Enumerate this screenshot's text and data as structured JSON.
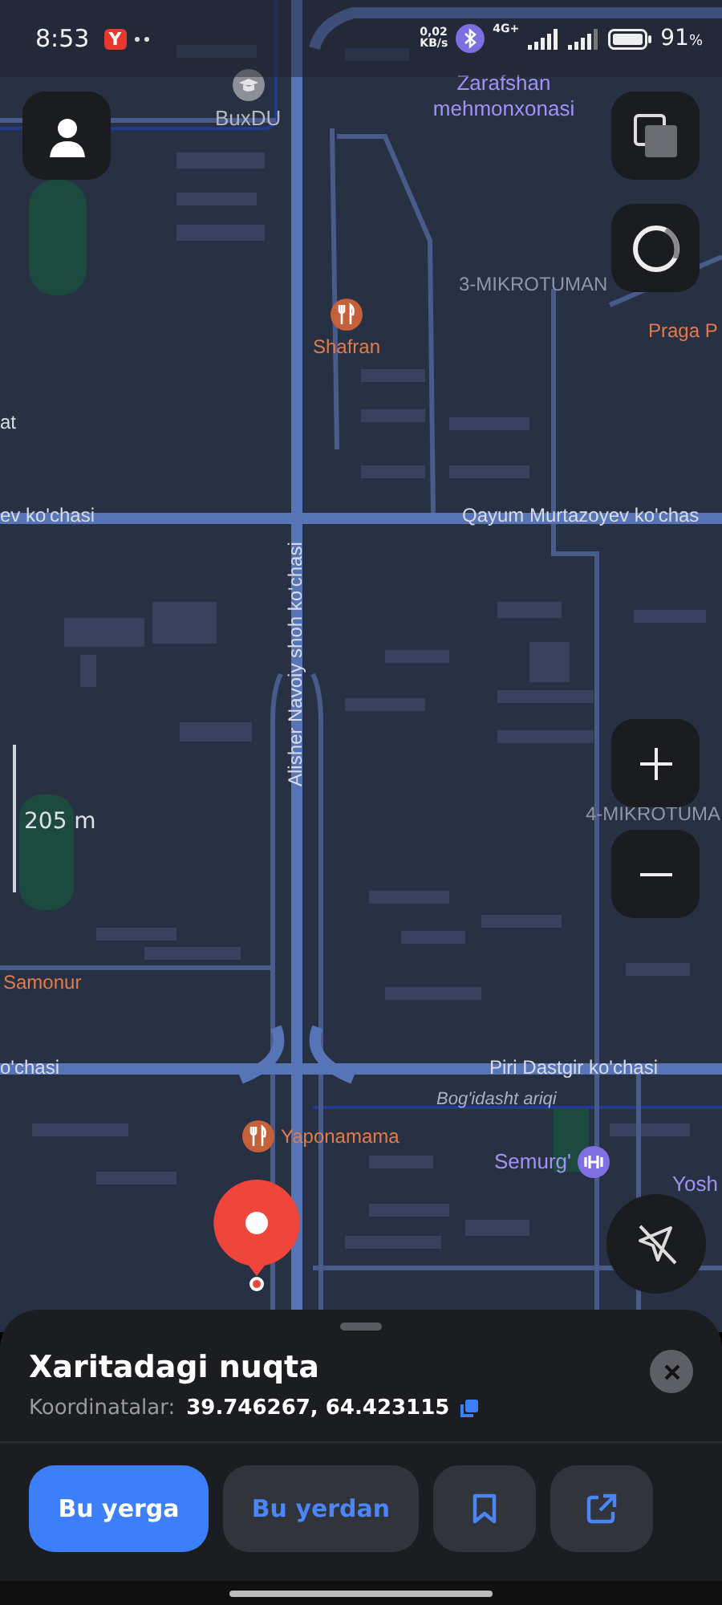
{
  "status_bar": {
    "time": "8:53",
    "app_badge": "Y",
    "speed_value": "0,02",
    "speed_unit": "KB/s",
    "network": "4G+",
    "battery_percent": "91",
    "battery_unit": "%"
  },
  "map": {
    "labels": [
      {
        "kind": "edu",
        "text": "BuxDU"
      },
      {
        "kind": "hotel",
        "text": "Zarafshan mehmonxonasi"
      },
      {
        "kind": "district",
        "text": "3-MIKROTUMAN"
      },
      {
        "kind": "food",
        "text": "Praga P"
      },
      {
        "kind": "food",
        "text": "Shafran"
      },
      {
        "kind": "place",
        "text": "at"
      },
      {
        "kind": "street",
        "text": "ev ko'chasi"
      },
      {
        "kind": "street",
        "text": "Qayum Murtazoyev ko'chas"
      },
      {
        "kind": "street-vertical",
        "text": "Alisher Navoiy shoh ko'chasi"
      },
      {
        "kind": "district",
        "text": "4-MIKROTUMA"
      },
      {
        "kind": "food",
        "text": "Samonur"
      },
      {
        "kind": "street",
        "text": "o'chasi"
      },
      {
        "kind": "street",
        "text": "Piri Dastgir ko'chasi"
      },
      {
        "kind": "water",
        "text": "Bog'idasht ariqi"
      },
      {
        "kind": "food",
        "text": "Yaponamama"
      },
      {
        "kind": "sport",
        "text": "Semurg'"
      },
      {
        "kind": "hotel",
        "text": "Yosh"
      }
    ],
    "scale": "205 m"
  },
  "place_card": {
    "title": "Xaritadagi nuqta",
    "coords_label": "Koordinatalar:",
    "coords": "39.746267, 64.423115"
  },
  "actions": [
    {
      "kind": "primary",
      "label": "Bu yerga"
    },
    {
      "kind": "secondary",
      "label": "Bu yerdan"
    },
    {
      "kind": "bookmark"
    },
    {
      "kind": "share"
    }
  ]
}
